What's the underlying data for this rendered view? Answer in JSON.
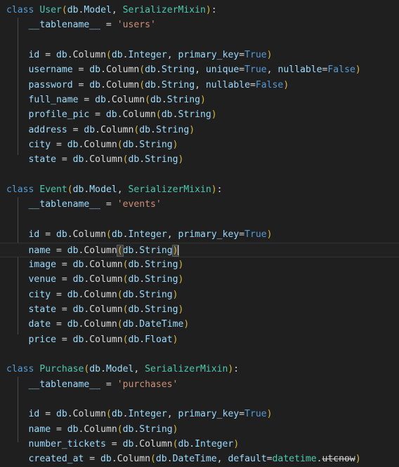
{
  "editor": {
    "language": "python",
    "theme": "dark-plus",
    "background_color": "#1f1f1f",
    "default_text_color": "#d4d4d4",
    "cursor_line": 16,
    "cursor_visible": true,
    "colors": {
      "keyword": "#569cd6",
      "class_name": "#4ec9b0",
      "bracket": "#d7ba3d",
      "variable": "#9cdcfe",
      "function": "#dcdcdc",
      "string": "#ce9178",
      "operator": "#d4d4d4",
      "indent_guide": "#4a4a4a",
      "active_line_bg": "#212121",
      "active_line_border": "#323232",
      "bracket_match_outline": "#5f5f5f"
    }
  },
  "classes": [
    {
      "name": "User",
      "bases": "db.Model, SerializerMixin",
      "tablename": "'users'",
      "fields": [
        "id = db.Column(db.Integer, primary_key=True)",
        "username = db.Column(db.String, unique=True, nullable=False)",
        "password = db.Column(db.String, nullable=False)",
        "full_name = db.Column(db.String)",
        "profile_pic = db.Column(db.String)",
        "address = db.Column(db.String)",
        "city = db.Column(db.String)",
        "state = db.Column(db.String)"
      ]
    },
    {
      "name": "Event",
      "bases": "db.Model, SerializerMixin",
      "tablename": "'events'",
      "fields": [
        "id = db.Column(db.Integer, primary_key=True)",
        "name = db.Column(db.String)",
        "image = db.Column(db.String)",
        "venue = db.Column(db.String)",
        "city = db.Column(db.String)",
        "state = db.Column(db.String)",
        "date = db.Column(db.DateTime)",
        "price = db.Column(db.Float)"
      ]
    },
    {
      "name": "Purchase",
      "bases": "db.Model, SerializerMixin",
      "tablename": "'purchases'",
      "fields": [
        "id = db.Column(db.Integer, primary_key=True)",
        "name = db.Column(db.String)",
        "number_tickets = db.Column(db.Integer)",
        "created_at = db.Column(db.DateTime, default=datetime.utcnow)"
      ]
    }
  ],
  "lines": {
    "l1": {
      "kw": "class",
      "name": "User",
      "open": "(",
      "bases_mod": "db",
      "dot": ".",
      "bases_attr": "Model",
      "comma": ", ",
      "mixin": "SerializerMixin",
      "close": ")",
      "colon": ":"
    },
    "l2": {
      "ident": "__tablename__",
      "eq": " = ",
      "str": "'users'"
    },
    "l4": {
      "name": "id",
      "eq": " = ",
      "mod": "db",
      "d1": ".",
      "fn": "Column",
      "op": "(",
      "a1mod": "db",
      "d2": ".",
      "a1": "Integer",
      "sep": ", ",
      "kwname": "primary_key",
      "kweq": "=",
      "kwval": "True",
      "cp": ")"
    },
    "l5": {
      "name": "username",
      "eq": " = ",
      "mod": "db",
      "d1": ".",
      "fn": "Column",
      "op": "(",
      "a1mod": "db",
      "d2": ".",
      "a1": "String",
      "sep": ", ",
      "kwname": "unique",
      "kweq": "=",
      "kwval": "True",
      "sep2": ", ",
      "kwname2": "nullable",
      "kweq2": "=",
      "kwval2": "False",
      "cp": ")"
    },
    "l6": {
      "name": "password",
      "eq": " = ",
      "mod": "db",
      "d1": ".",
      "fn": "Column",
      "op": "(",
      "a1mod": "db",
      "d2": ".",
      "a1": "String",
      "sep": ", ",
      "kwname": "nullable",
      "kweq": "=",
      "kwval": "False",
      "cp": ")"
    },
    "l7": {
      "name": "full_name",
      "a1": "String"
    },
    "l8": {
      "name": "profile_pic",
      "a1": "String"
    },
    "l9": {
      "name": "address",
      "a1": "String"
    },
    "l10": {
      "name": "city",
      "a1": "String"
    },
    "l11": {
      "name": "state",
      "a1": "String"
    },
    "l13": {
      "kw": "class",
      "name": "Event",
      "open": "(",
      "bases_mod": "db",
      "dot": ".",
      "bases_attr": "Model",
      "comma": ", ",
      "mixin": "SerializerMixin",
      "close": ")",
      "colon": ":"
    },
    "l14": {
      "ident": "__tablename__",
      "eq": " = ",
      "str": "'events'"
    },
    "l16": {
      "name": "id",
      "kwname": "primary_key",
      "kwval": "True",
      "a1": "Integer"
    },
    "l17": {
      "name": "name",
      "a1": "String"
    },
    "l18": {
      "name": "image",
      "a1": "String"
    },
    "l19": {
      "name": "venue",
      "a1": "String"
    },
    "l20": {
      "name": "city",
      "a1": "String"
    },
    "l21": {
      "name": "state",
      "a1": "String"
    },
    "l22": {
      "name": "date",
      "a1": "DateTime"
    },
    "l23": {
      "name": "price",
      "a1": "Float"
    },
    "l25": {
      "kw": "class",
      "name": "Purchase",
      "open": "(",
      "bases_mod": "db",
      "dot": ".",
      "bases_attr": "Model",
      "comma": ", ",
      "mixin": "SerializerMixin",
      "close": ")",
      "colon": ":"
    },
    "l26": {
      "ident": "__tablename__",
      "eq": " = ",
      "str": "'purchases'"
    },
    "l28": {
      "name": "id",
      "a1": "Integer",
      "kwname": "primary_key",
      "kwval": "True"
    },
    "l29": {
      "name": "name",
      "a1": "String"
    },
    "l30": {
      "name": "number_tickets",
      "a1": "Integer"
    },
    "l31": {
      "name": "created_at",
      "a1": "DateTime",
      "kwname": "default",
      "mod2": "datetime",
      "attr2": "utcnow"
    }
  },
  "common": {
    "db": "db",
    "dot": ".",
    "column": "Column",
    "open_paren": "(",
    "close_paren": ")",
    "comma": ", ",
    "equals": " = ",
    "assign": "=",
    "indent": "    ",
    "blank": ""
  }
}
